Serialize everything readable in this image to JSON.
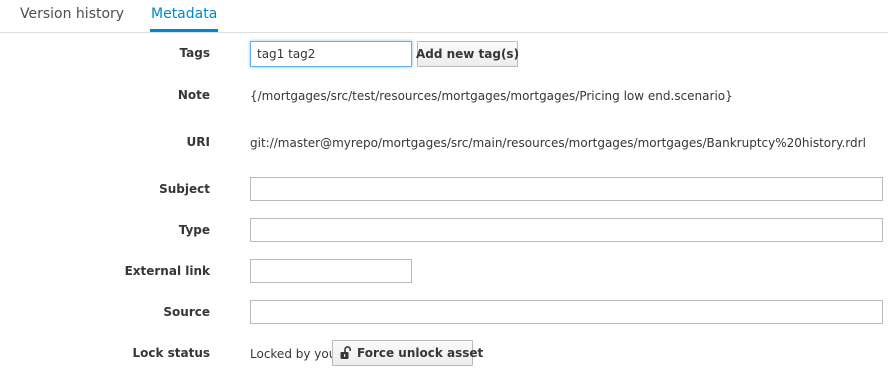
{
  "tabs": [
    {
      "label": "Version history",
      "active": false
    },
    {
      "label": "Metadata",
      "active": true
    }
  ],
  "colors": {
    "accent": "#0088ce",
    "border": "#bababa",
    "focus": "#66afe9"
  },
  "metadata": {
    "tags": {
      "label": "Tags",
      "value": "tag1 tag2",
      "button_label": "Add new tag(s)"
    },
    "note": {
      "label": "Note",
      "value": "{/mortgages/src/test/resources/mortgages/mortgages/Pricing low end.scenario}"
    },
    "uri": {
      "label": "URI",
      "value": "git://master@myrepo/mortgages/src/main/resources/mortgages/mortgages/Bankruptcy%20history.rdrl"
    },
    "subject": {
      "label": "Subject",
      "value": ""
    },
    "type": {
      "label": "Type",
      "value": ""
    },
    "external_link": {
      "label": "External link",
      "value": ""
    },
    "source": {
      "label": "Source",
      "value": ""
    },
    "lock_status": {
      "label": "Lock status",
      "value": "Locked by you",
      "button_label": "Force unlock asset",
      "icon": "unlock-icon"
    }
  }
}
